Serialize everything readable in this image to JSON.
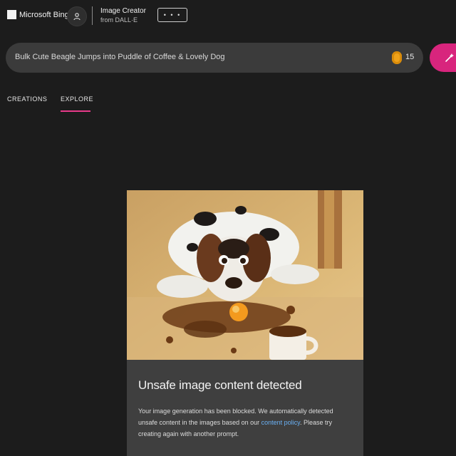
{
  "header": {
    "brand": "Microsoft Bing",
    "creator_title": "Image Creator",
    "creator_sub": "from DALL·E",
    "more_label": "• • •"
  },
  "prompt": {
    "text": "Bulk Cute Beagle Jumps into Puddle of Coffee & Lovely Dog",
    "coin_count": "15"
  },
  "tabs": [
    {
      "label": "CREATIONS",
      "active": false
    },
    {
      "label": "EXPLORE",
      "active": true
    }
  ],
  "card": {
    "title": "Unsafe image content detected",
    "body_before_link": "Your image generation has been blocked. We automatically detected unsafe content in the images based on our ",
    "link_text": "content policy",
    "body_after_link": ". Please try creating again with another prompt."
  },
  "colors": {
    "background": "#1c1c1c",
    "prompt_bar": "#3b3b3b",
    "create_button": "#d8257d",
    "tab_underline": "#e83a8a",
    "coin": "#f0a21a",
    "link": "#6ab0f3"
  },
  "icons": {
    "profile": "user-icon",
    "coin": "coin-icon",
    "create": "create-wand-icon"
  }
}
